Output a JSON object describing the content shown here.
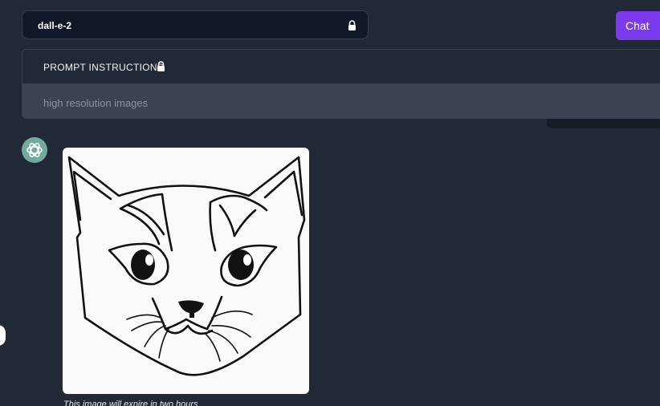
{
  "model_select": {
    "value": "dall-e-2",
    "icon": "lock-icon"
  },
  "header": {
    "chat_label": "Chat"
  },
  "prompt_instructions": {
    "title": "PROMPT INSTRUCTIONS",
    "icon": "lock-icon",
    "text": "high resolution images"
  },
  "message": {
    "avatar_icon": "openai-logo-icon",
    "image_alt": "line drawing of a cat face",
    "note": "This image will expire in two hours"
  },
  "colors": {
    "background": "#222936",
    "accent": "#7c3aed",
    "avatar": "#74aa9c",
    "panel": "#3b4352"
  }
}
